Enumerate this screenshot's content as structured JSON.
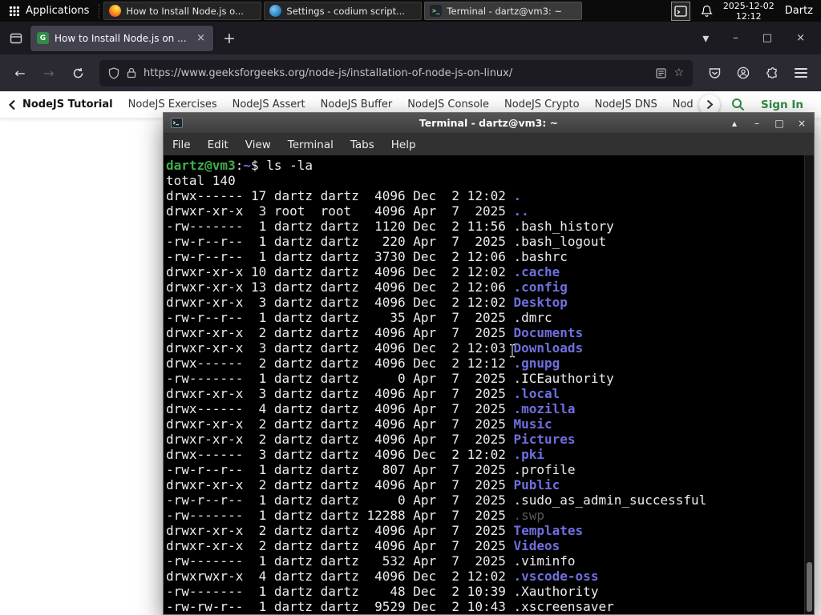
{
  "panel": {
    "applications_label": "Applications",
    "taskbar": [
      {
        "label": "How to Install Node.js o...",
        "icon": "firefox",
        "active": false
      },
      {
        "label": "Settings - codium script...",
        "icon": "codium",
        "active": false
      },
      {
        "label": "Terminal - dartz@vm3: ~",
        "icon": "terminal",
        "active": true
      }
    ],
    "clock": {
      "date": "2025-12-02",
      "time": "12:12"
    },
    "user": "Dartz"
  },
  "browser": {
    "tab": {
      "title": "How to Install Node.js on ..."
    },
    "url": "https://www.geeksforgeeks.org/node-js/installation-of-node-js-on-linux/",
    "gfg": {
      "items": [
        "NodeJS Tutorial",
        "NodeJS Exercises",
        "NodeJS Assert",
        "NodeJS Buffer",
        "NodeJS Console",
        "NodeJS Crypto",
        "NodeJS DNS",
        "Node"
      ],
      "sign_in": "Sign In"
    }
  },
  "terminal": {
    "title": "Terminal - dartz@vm3: ~",
    "menu": [
      "File",
      "Edit",
      "View",
      "Terminal",
      "Tabs",
      "Help"
    ],
    "prompt": {
      "userhost": "dartz@vm3",
      "colon": ":",
      "cwd": "~",
      "dollar": "$ ",
      "command": "ls -la"
    },
    "total": "total 140",
    "listing": [
      {
        "pre": "drwx------ 17 dartz dartz  4096 Dec  2 12:02 ",
        "name": ".",
        "kind": "dir"
      },
      {
        "pre": "drwxr-xr-x  3 root  root   4096 Apr  7  2025 ",
        "name": "..",
        "kind": "dir"
      },
      {
        "pre": "-rw-------  1 dartz dartz  1120 Dec  2 11:56 ",
        "name": ".bash_history",
        "kind": "file"
      },
      {
        "pre": "-rw-r--r--  1 dartz dartz   220 Apr  7  2025 ",
        "name": ".bash_logout",
        "kind": "file"
      },
      {
        "pre": "-rw-r--r--  1 dartz dartz  3730 Dec  2 12:06 ",
        "name": ".bashrc",
        "kind": "file"
      },
      {
        "pre": "drwxr-xr-x 10 dartz dartz  4096 Dec  2 12:02 ",
        "name": ".cache",
        "kind": "dir"
      },
      {
        "pre": "drwxr-xr-x 13 dartz dartz  4096 Dec  2 12:06 ",
        "name": ".config",
        "kind": "dir"
      },
      {
        "pre": "drwxr-xr-x  3 dartz dartz  4096 Dec  2 12:02 ",
        "name": "Desktop",
        "kind": "dir"
      },
      {
        "pre": "-rw-r--r--  1 dartz dartz    35 Apr  7  2025 ",
        "name": ".dmrc",
        "kind": "file"
      },
      {
        "pre": "drwxr-xr-x  2 dartz dartz  4096 Apr  7  2025 ",
        "name": "Documents",
        "kind": "dir"
      },
      {
        "pre": "drwxr-xr-x  3 dartz dartz  4096 Dec  2 12:03 ",
        "name": "Downloads",
        "kind": "dir"
      },
      {
        "pre": "drwx------  2 dartz dartz  4096 Dec  2 12:12 ",
        "name": ".gnupg",
        "kind": "dir"
      },
      {
        "pre": "-rw-------  1 dartz dartz     0 Apr  7  2025 ",
        "name": ".ICEauthority",
        "kind": "file"
      },
      {
        "pre": "drwxr-xr-x  3 dartz dartz  4096 Apr  7  2025 ",
        "name": ".local",
        "kind": "dir"
      },
      {
        "pre": "drwx------  4 dartz dartz  4096 Apr  7  2025 ",
        "name": ".mozilla",
        "kind": "dir"
      },
      {
        "pre": "drwxr-xr-x  2 dartz dartz  4096 Apr  7  2025 ",
        "name": "Music",
        "kind": "dir"
      },
      {
        "pre": "drwxr-xr-x  2 dartz dartz  4096 Apr  7  2025 ",
        "name": "Pictures",
        "kind": "dir"
      },
      {
        "pre": "drwx------  3 dartz dartz  4096 Dec  2 12:02 ",
        "name": ".pki",
        "kind": "dir"
      },
      {
        "pre": "-rw-r--r--  1 dartz dartz   807 Apr  7  2025 ",
        "name": ".profile",
        "kind": "file"
      },
      {
        "pre": "drwxr-xr-x  2 dartz dartz  4096 Apr  7  2025 ",
        "name": "Public",
        "kind": "dir"
      },
      {
        "pre": "-rw-r--r--  1 dartz dartz     0 Apr  7  2025 ",
        "name": ".sudo_as_admin_successful",
        "kind": "file"
      },
      {
        "pre": "-rw-------  1 dartz dartz 12288 Apr  7  2025 ",
        "name": ".swp",
        "kind": "dim"
      },
      {
        "pre": "drwxr-xr-x  2 dartz dartz  4096 Apr  7  2025 ",
        "name": "Templates",
        "kind": "dir"
      },
      {
        "pre": "drwxr-xr-x  2 dartz dartz  4096 Apr  7  2025 ",
        "name": "Videos",
        "kind": "dir"
      },
      {
        "pre": "-rw-------  1 dartz dartz   532 Apr  7  2025 ",
        "name": ".viminfo",
        "kind": "file"
      },
      {
        "pre": "drwxrwxr-x  4 dartz dartz  4096 Dec  2 12:02 ",
        "name": ".vscode-oss",
        "kind": "dir"
      },
      {
        "pre": "-rw-------  1 dartz dartz    48 Dec  2 10:39 ",
        "name": ".Xauthority",
        "kind": "file"
      },
      {
        "pre": "-rw-rw-r--  1 dartz dartz  9529 Dec  2 10:43 ",
        "name": ".xscreensaver",
        "kind": "file"
      }
    ]
  },
  "icons": {
    "close": "×",
    "minimize": "–",
    "maximize": "□",
    "shade": "▴",
    "tab_list_chevron": "▾",
    "new_tab": "+",
    "back": "←",
    "forward": "→",
    "star": "☆",
    "terminal_glyph": ">_"
  },
  "colors": {
    "gfg_green": "#2f8d46",
    "terminal_prompt_green": "#3fae4c",
    "terminal_dir_blue": "#6f6fdf",
    "terminal_dim_gray": "#5a5a5a"
  }
}
